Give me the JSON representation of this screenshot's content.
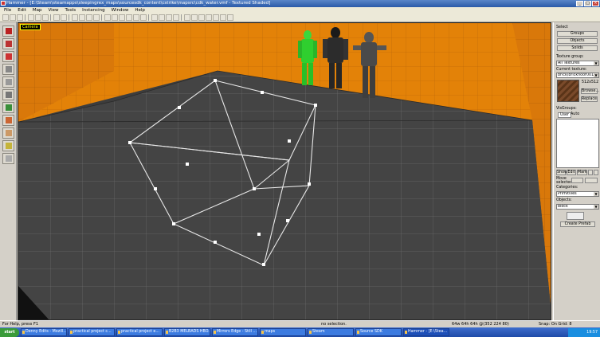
{
  "window": {
    "title": "Hammer - [E:\\Steam\\steamapps\\sleepingrex_maps\\sourcesdk_content\\cstrike\\mapsrc\\cdk_water.vmf - Textured Shaded]",
    "icon": "hammer-icon",
    "minimize": "_",
    "maximize": "□",
    "close": "×"
  },
  "menu": [
    "File",
    "Edit",
    "Map",
    "View",
    "Tools",
    "Instancing",
    "Window",
    "Help"
  ],
  "viewport": {
    "camera_label": "Camera"
  },
  "right_panel": {
    "select_label": "Select",
    "groups_btn": "Groups",
    "objects_btn": "Objects",
    "solids_btn": "Solids",
    "texture_group_label": "Texture group:",
    "texture_group_value": "All Textures",
    "current_texture_label": "Current texture:",
    "current_texture_value": "brick/brickfloor001a",
    "texture_size": "512x512",
    "browse_btn": "Browse...",
    "replace_btn": "Replace",
    "visgroups_label": "VisGroups:",
    "tab_user": "User",
    "tab_auto": "Auto",
    "show_btn": "Show",
    "edit_btn": "Edit",
    "mark_btn": "Mark",
    "move_selected_label": "Move selected:",
    "categories_label": "Categories:",
    "categories_value": "Primitives",
    "objects_label": "Objects:",
    "objects_value": "block",
    "create_prefab_btn": "Create Prefab"
  },
  "statusbar": {
    "help": "For Help, press F1",
    "selection": "no selection.",
    "coords": "64w 64h 64h @(352 224 80)",
    "snap": "Snap: On Grid: 8"
  },
  "taskbar": {
    "start": "start",
    "tasks": [
      "Denny Edits - Mozill...",
      "practical project c...",
      "practical project e...",
      "B2B3 MELBADS HBO...",
      "Mirrors Edge - Still ...",
      "maps",
      "Steam",
      "Source SDK",
      "Hammer - [E:\\Stea..."
    ],
    "clock": "19:57"
  }
}
